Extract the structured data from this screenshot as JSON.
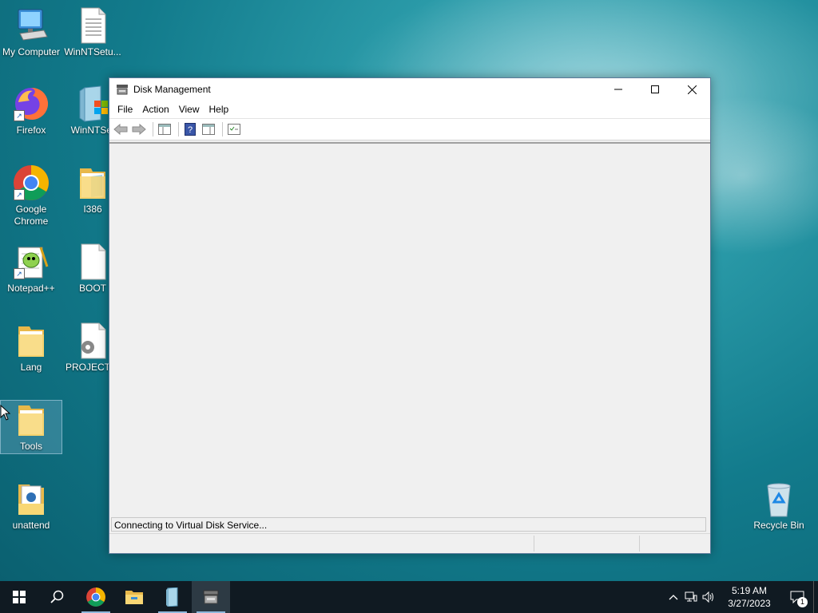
{
  "desktop": {
    "icons": [
      {
        "label": "My Computer"
      },
      {
        "label": "WinNTSetu..."
      },
      {
        "label": "Firefox"
      },
      {
        "label": "WinNTSet"
      },
      {
        "label": "Google Chrome"
      },
      {
        "label": "I386"
      },
      {
        "label": "Notepad++"
      },
      {
        "label": "BOOT"
      },
      {
        "label": "Lang"
      },
      {
        "label": "PROJECTIN"
      },
      {
        "label": "Tools"
      },
      {
        "label": "unattend"
      },
      {
        "label": "Recycle Bin"
      }
    ]
  },
  "window": {
    "title": "Disk Management",
    "menu": [
      "File",
      "Action",
      "View",
      "Help"
    ],
    "status_text": "Connecting to Virtual Disk Service..."
  },
  "taskbar": {
    "apps": [
      "start-icon",
      "search-icon",
      "chrome-icon",
      "file-explorer-icon",
      "winntsetup-icon",
      "disk-management-icon"
    ],
    "clock_time": "5:19 AM",
    "clock_date": "3/27/2023",
    "notification_count": "1"
  }
}
